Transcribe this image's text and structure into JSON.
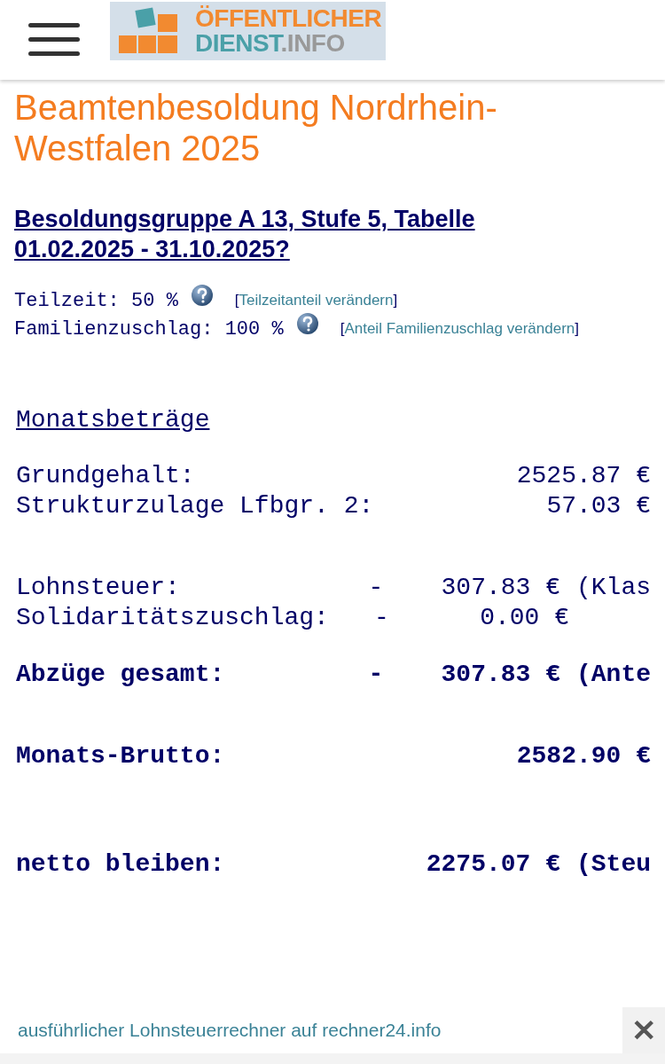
{
  "header": {
    "logo": {
      "line1": "ÖFFENTLICHER",
      "line2_main": "DIENST",
      "line2_suffix": ".INFO"
    }
  },
  "title": "Beamtenbesoldung Nordrhein-Westfalen 2025",
  "subtitle": "Besoldungsgruppe A 13, Stufe 5, Tabelle 01.02.2025 - 31.10.2025?",
  "settings": [
    {
      "label": "Teilzeit: 50 %",
      "open": "[",
      "link": "Teilzeitanteil verändern",
      "close": "]"
    },
    {
      "label": "Familienzuschlag: 100 %",
      "open": "[",
      "link": "Anteil Familienzuschlag verändern",
      "close": "]"
    }
  ],
  "section_title": "Monatsbeträge",
  "groups": [
    [
      {
        "kind": "plain",
        "label": "Grundgehalt:",
        "amount": "2525.87 €",
        "bold": false
      },
      {
        "kind": "plain",
        "label": "Strukturzulage Lfbgr. 2:",
        "amount": "57.03 €",
        "bold": false
      }
    ],
    [
      {
        "kind": "deduction",
        "label": "Lohnsteuer:",
        "sign": "-",
        "amount": "307.83 €",
        "note": "(Klas",
        "bold": false
      },
      {
        "kind": "deduction",
        "label": "Solidaritätszuschlag:",
        "sign": "-",
        "amount": "0.00 €",
        "bold": false
      }
    ],
    [
      {
        "kind": "deduction",
        "label": "Abzüge gesamt:",
        "sign": "-",
        "amount": "307.83 €",
        "note": "(Ante",
        "bold": true
      }
    ],
    [
      {
        "kind": "plain",
        "label": "Monats-Brutto:",
        "amount": "2582.90 €",
        "bold": true
      }
    ],
    [
      {
        "kind": "deduction",
        "label": "netto bleiben:",
        "amount": "2275.07 €",
        "note": "(Steu",
        "bold": true
      }
    ]
  ],
  "banner": {
    "link": "ausführlicher Lohnsteuerrechner auf rechner24.info",
    "close": "✕"
  }
}
